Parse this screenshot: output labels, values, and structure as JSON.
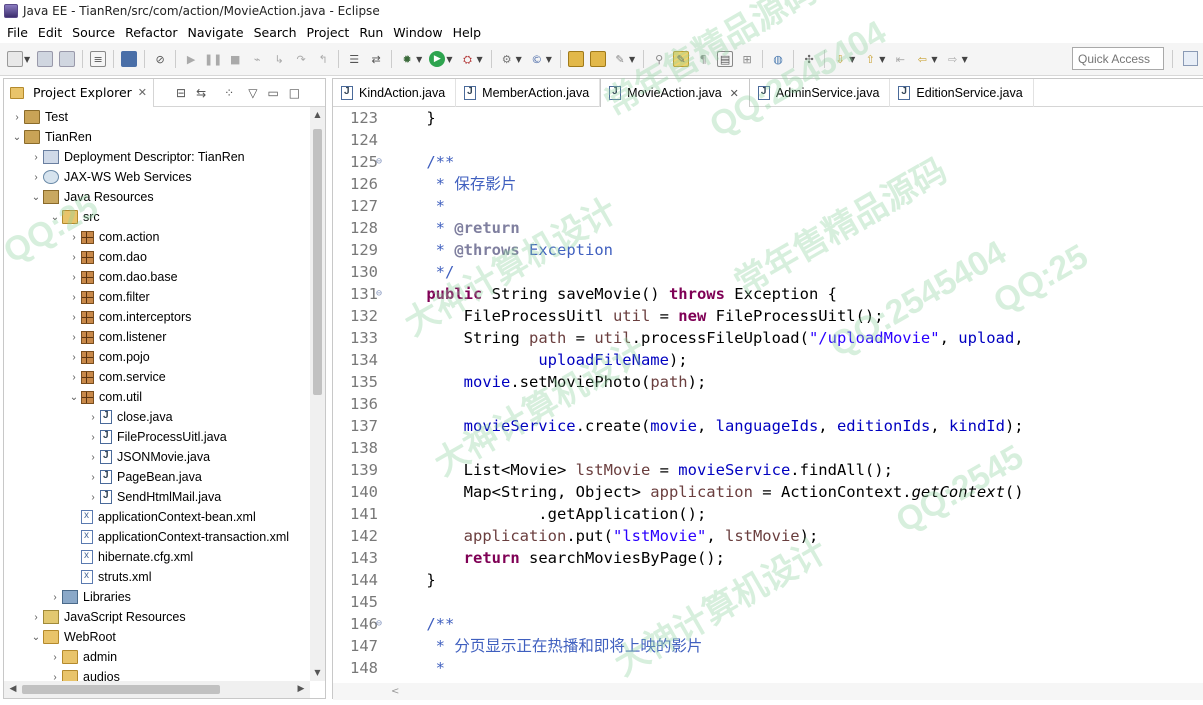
{
  "window": {
    "title": "Java EE - TianRen/src/com/action/MovieAction.java - Eclipse"
  },
  "menu": [
    "File",
    "Edit",
    "Source",
    "Refactor",
    "Navigate",
    "Search",
    "Project",
    "Run",
    "Window",
    "Help"
  ],
  "toolbar": {
    "quick_access_placeholder": "Quick Access"
  },
  "explorer": {
    "title": "Project Explorer",
    "items": [
      {
        "label": "Test",
        "depth": 0,
        "arrow": "›",
        "icon": "project"
      },
      {
        "label": "TianRen",
        "depth": 0,
        "arrow": "⌄",
        "icon": "project"
      },
      {
        "label": "Deployment Descriptor: TianRen",
        "depth": 1,
        "arrow": "›",
        "icon": "desc"
      },
      {
        "label": "JAX-WS Web Services",
        "depth": 1,
        "arrow": "›",
        "icon": "ws"
      },
      {
        "label": "Java Resources",
        "depth": 1,
        "arrow": "⌄",
        "icon": "jres"
      },
      {
        "label": "src",
        "depth": 2,
        "arrow": "⌄",
        "icon": "folder"
      },
      {
        "label": "com.action",
        "depth": 3,
        "arrow": "›",
        "icon": "pkg"
      },
      {
        "label": "com.dao",
        "depth": 3,
        "arrow": "›",
        "icon": "pkg"
      },
      {
        "label": "com.dao.base",
        "depth": 3,
        "arrow": "›",
        "icon": "pkg"
      },
      {
        "label": "com.filter",
        "depth": 3,
        "arrow": "›",
        "icon": "pkg"
      },
      {
        "label": "com.interceptors",
        "depth": 3,
        "arrow": "›",
        "icon": "pkg"
      },
      {
        "label": "com.listener",
        "depth": 3,
        "arrow": "›",
        "icon": "pkg"
      },
      {
        "label": "com.pojo",
        "depth": 3,
        "arrow": "›",
        "icon": "pkg"
      },
      {
        "label": "com.service",
        "depth": 3,
        "arrow": "›",
        "icon": "pkg"
      },
      {
        "label": "com.util",
        "depth": 3,
        "arrow": "⌄",
        "icon": "pkg"
      },
      {
        "label": "close.java",
        "depth": 4,
        "arrow": "›",
        "icon": "java"
      },
      {
        "label": "FileProcessUitl.java",
        "depth": 4,
        "arrow": "›",
        "icon": "java"
      },
      {
        "label": "JSONMovie.java",
        "depth": 4,
        "arrow": "›",
        "icon": "java"
      },
      {
        "label": "PageBean.java",
        "depth": 4,
        "arrow": "›",
        "icon": "java"
      },
      {
        "label": "SendHtmlMail.java",
        "depth": 4,
        "arrow": "›",
        "icon": "java"
      },
      {
        "label": "applicationContext-bean.xml",
        "depth": 3,
        "arrow": "",
        "icon": "xml"
      },
      {
        "label": "applicationContext-transaction.xml",
        "depth": 3,
        "arrow": "",
        "icon": "xml"
      },
      {
        "label": "hibernate.cfg.xml",
        "depth": 3,
        "arrow": "",
        "icon": "xml"
      },
      {
        "label": "struts.xml",
        "depth": 3,
        "arrow": "",
        "icon": "xml"
      },
      {
        "label": "Libraries",
        "depth": 2,
        "arrow": "›",
        "icon": "lib"
      },
      {
        "label": "JavaScript Resources",
        "depth": 1,
        "arrow": "›",
        "icon": "jsr"
      },
      {
        "label": "WebRoot",
        "depth": 1,
        "arrow": "⌄",
        "icon": "folder"
      },
      {
        "label": "admin",
        "depth": 2,
        "arrow": "›",
        "icon": "folder"
      },
      {
        "label": "audios",
        "depth": 2,
        "arrow": "›",
        "icon": "folder"
      }
    ]
  },
  "editor": {
    "tabs": [
      {
        "label": "KindAction.java",
        "active": false
      },
      {
        "label": "MemberAction.java",
        "active": false
      },
      {
        "label": "MovieAction.java",
        "active": true
      },
      {
        "label": "AdminService.java",
        "active": false
      },
      {
        "label": "EditionService.java",
        "active": false
      }
    ],
    "lines": [
      {
        "n": "123",
        "fold": "",
        "html": "    }"
      },
      {
        "n": "124",
        "fold": "",
        "html": ""
      },
      {
        "n": "125",
        "fold": "⊖",
        "html": "    <span class='cm'>/**</span>"
      },
      {
        "n": "126",
        "fold": "",
        "html": "     <span class='cm'>* 保存影片</span>"
      },
      {
        "n": "127",
        "fold": "",
        "html": "     <span class='cm'>*</span>"
      },
      {
        "n": "128",
        "fold": "",
        "html": "     <span class='cm'>* </span><span class='tag'>@return</span>"
      },
      {
        "n": "129",
        "fold": "",
        "html": "     <span class='cm'>* </span><span class='tag'>@throws</span><span class='cm'> Exception</span>"
      },
      {
        "n": "130",
        "fold": "",
        "html": "     <span class='cm'>*/</span>"
      },
      {
        "n": "131",
        "fold": "⊖",
        "html": "    <span class='kw'>public</span> String saveMovie() <span class='kw'>throws</span> Exception {"
      },
      {
        "n": "132",
        "fold": "",
        "html": "        FileProcessUitl <span class='lv'>util</span> = <span class='kw'>new</span> FileProcessUitl();"
      },
      {
        "n": "133",
        "fold": "",
        "html": "        String <span class='lv'>path</span> = <span class='lv'>util</span>.processFileUpload(<span class='str'>\"/uploadMovie\"</span>, <span class='fld'>upload</span>,"
      },
      {
        "n": "134",
        "fold": "",
        "html": "                <span class='fld'>uploadFileName</span>);"
      },
      {
        "n": "135",
        "fold": "",
        "html": "        <span class='fld'>movie</span>.setMoviePhoto(<span class='lv'>path</span>);"
      },
      {
        "n": "136",
        "fold": "",
        "html": ""
      },
      {
        "n": "137",
        "fold": "",
        "html": "        <span class='fld'>movieService</span>.create(<span class='fld'>movie</span>, <span class='fld'>languageIds</span>, <span class='fld'>editionIds</span>, <span class='fld'>kindId</span>);"
      },
      {
        "n": "138",
        "fold": "",
        "html": ""
      },
      {
        "n": "139",
        "fold": "",
        "html": "        List&lt;Movie&gt; <span class='lv'>lstMovie</span> = <span class='fld'>movieService</span>.findAll();"
      },
      {
        "n": "140",
        "fold": "",
        "html": "        Map&lt;String, Object&gt; <span class='lv'>application</span> = ActionContext.<span class='it'>getContext</span>()"
      },
      {
        "n": "141",
        "fold": "",
        "html": "                .getApplication();"
      },
      {
        "n": "142",
        "fold": "",
        "html": "        <span class='lv'>application</span>.put(<span class='str'>\"lstMovie\"</span>, <span class='lv'>lstMovie</span>);"
      },
      {
        "n": "143",
        "fold": "",
        "html": "        <span class='kw'>return</span> searchMoviesByPage();"
      },
      {
        "n": "144",
        "fold": "",
        "html": "    }"
      },
      {
        "n": "145",
        "fold": "",
        "html": ""
      },
      {
        "n": "146",
        "fold": "⊖",
        "html": "    <span class='cm'>/**</span>"
      },
      {
        "n": "147",
        "fold": "",
        "html": "     <span class='cm'>* 分页显示正在热播和即将上映的影片</span>"
      },
      {
        "n": "148",
        "fold": "",
        "html": "     <span class='cm'>*</span>"
      }
    ]
  },
  "watermarks": [
    "常年售精品源码",
    "QQ:2545404",
    "大神计算机设计",
    "常年售精品源码",
    "QQ:2545404",
    "大神计算机设计",
    "QQ:25",
    "QQ:25",
    "QQ:2545",
    "大神计算机设计"
  ]
}
